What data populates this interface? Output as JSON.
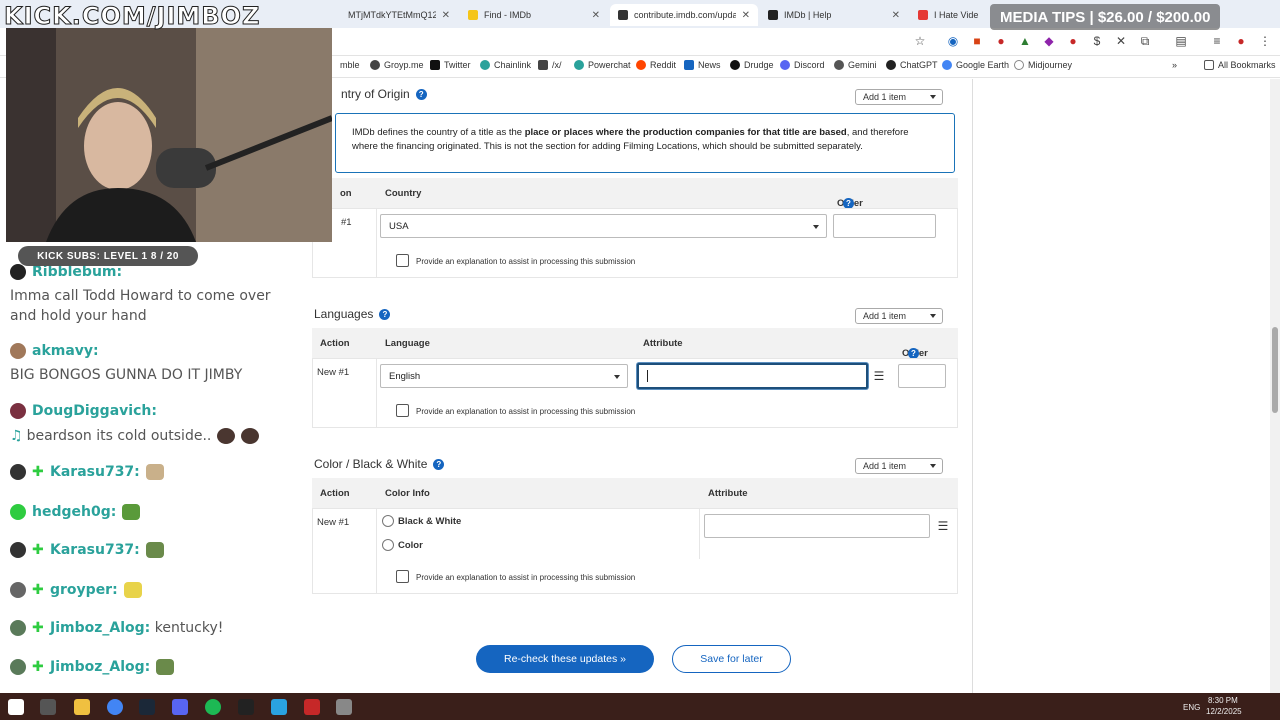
{
  "overlay": {
    "kick_url": "KICK.COM/JIMBOZ",
    "media_tips": "MEDIA TIPS | $26.00 / $200.00",
    "subs_goal": "KICK SUBS: LEVEL 1 8 / 20"
  },
  "tabs": [
    {
      "title": "MTjMTdkYTEtMmQ12",
      "active": false
    },
    {
      "title": "Find - IMDb",
      "active": false
    },
    {
      "title": "contribute.imdb.com/update",
      "active": true
    },
    {
      "title": "IMDb | Help",
      "active": false
    },
    {
      "title": "I Hate Vide",
      "active": false
    }
  ],
  "bookmarks": [
    "mble",
    "Groyp.me",
    "Twitter",
    "Chainlink",
    "/x/",
    "Powerchat",
    "Reddit",
    "News",
    "Drudge",
    "Discord",
    "Gemini",
    "ChatGPT",
    "Google Earth",
    "Midjourney"
  ],
  "all_bookmarks": "All Bookmarks",
  "country": {
    "title": "ntry of Origin",
    "add_label": "Add 1 item",
    "info_1": "IMDb defines the country of a title as the ",
    "info_bold": "place or places where the production companies for that title are based",
    "info_2": ", and therefore",
    "info_3": "where the financing originated. This is not the section for adding Filming Locations, which should be submitted separately.",
    "col_action": "on",
    "col_country": "Country",
    "col_order": "Order",
    "row_label": "#1",
    "value": "USA",
    "explain": "Provide an explanation to assist in processing this submission"
  },
  "languages": {
    "title": "Languages",
    "add_label": "Add 1 item",
    "col_action": "Action",
    "col_language": "Language",
    "col_attribute": "Attribute",
    "col_order": "Order",
    "row_label": "New #1",
    "value": "English",
    "explain": "Provide an explanation to assist in processing this submission"
  },
  "color": {
    "title": "Color / Black & White",
    "add_label": "Add 1 item",
    "col_action": "Action",
    "col_info": "Color Info",
    "col_attribute": "Attribute",
    "row_label": "New #1",
    "opt_bw": "Black & White",
    "opt_color": "Color",
    "explain": "Provide an explanation to assist in processing this submission"
  },
  "buttons": {
    "recheck": "Re-check these updates »",
    "save_later": "Save for later"
  },
  "chat": [
    {
      "user": "Ribblebum:",
      "text": ""
    },
    {
      "user": "",
      "text": "Imma call Todd Howard to come over and hold your hand"
    },
    {
      "user": "akmavy:",
      "text": ""
    },
    {
      "user": "",
      "text": "BIG BONGOS GUNNA DO IT JIMBY"
    },
    {
      "user": "DougDiggavich:",
      "text": ""
    },
    {
      "user": "",
      "text": "beardson its cold outside.."
    },
    {
      "user": "Karasu737:",
      "text": ""
    },
    {
      "user": "hedgeh0g:",
      "text": ""
    },
    {
      "user": "Karasu737:",
      "text": ""
    },
    {
      "user": "groyper:",
      "text": ""
    },
    {
      "user": "Jimboz_Alog:",
      "text": "kentucky!"
    },
    {
      "user": "Jimboz_Alog:",
      "text": ""
    }
  ],
  "tray": {
    "lang": "ENG",
    "time": "8:30 PM",
    "date": "12/2/2025"
  },
  "colors": {
    "accent": "#1565c0",
    "focus": "#1d4f7a",
    "chat_name": "#2aa29b"
  }
}
